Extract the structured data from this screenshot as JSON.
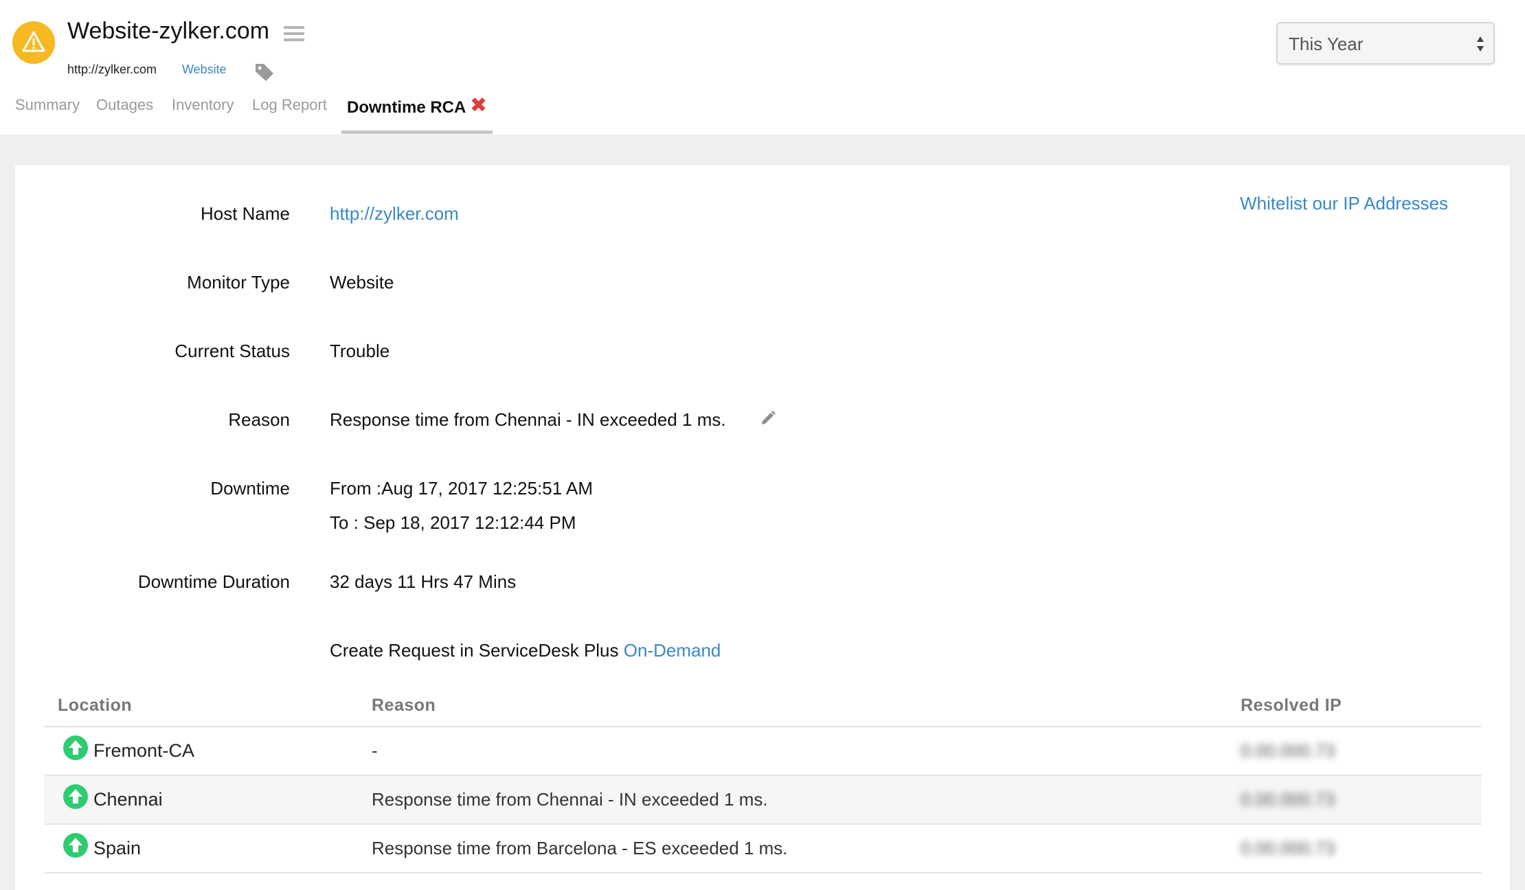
{
  "header": {
    "title": "Website-zylker.com",
    "host_url": "http://zylker.com",
    "monitor_type": "Website",
    "tabs": [
      {
        "label": "Summary"
      },
      {
        "label": "Outages"
      },
      {
        "label": "Inventory"
      },
      {
        "label": "Log Report"
      }
    ],
    "active_tab": "Downtime RCA",
    "period_select": {
      "selected": "This Year"
    }
  },
  "details": {
    "whitelist_link": "Whitelist our IP Addresses",
    "host_name_label": "Host Name",
    "host_name_value": "http://zylker.com",
    "monitor_type_label": "Monitor Type",
    "monitor_type_value": "Website",
    "current_status_label": "Current Status",
    "current_status_value": "Trouble",
    "reason_label": "Reason",
    "reason_value": "Response time from Chennai - IN exceeded 1 ms.",
    "downtime_label": "Downtime",
    "downtime_from": "From :Aug 17, 2017 12:25:51 AM",
    "downtime_to": "To : Sep 18, 2017 12:12:44 PM",
    "duration_label": "Downtime Duration",
    "duration_value": "32 days 11 Hrs 47 Mins",
    "request_text": "Create Request in ServiceDesk Plus",
    "request_link": "On-Demand"
  },
  "locations": {
    "headers": {
      "location": "Location",
      "reason": "Reason",
      "resolved_ip": "Resolved IP"
    },
    "rows": [
      {
        "location": "Fremont-CA",
        "reason": "-",
        "resolved_ip": "0.00.000.73",
        "status": "up"
      },
      {
        "location": "Chennai",
        "reason": "Response time from Chennai - IN exceeded 1 ms.",
        "resolved_ip": "0.00.000.73",
        "status": "up"
      },
      {
        "location": "Spain",
        "reason": "Response time from Barcelona - ES exceeded 1 ms.",
        "resolved_ip": "0.00.000.73",
        "status": "up"
      }
    ]
  },
  "colors": {
    "warning": "#f6b922",
    "link": "#3a87c6",
    "close": "#e23b3b",
    "up": "#2ecc71"
  }
}
